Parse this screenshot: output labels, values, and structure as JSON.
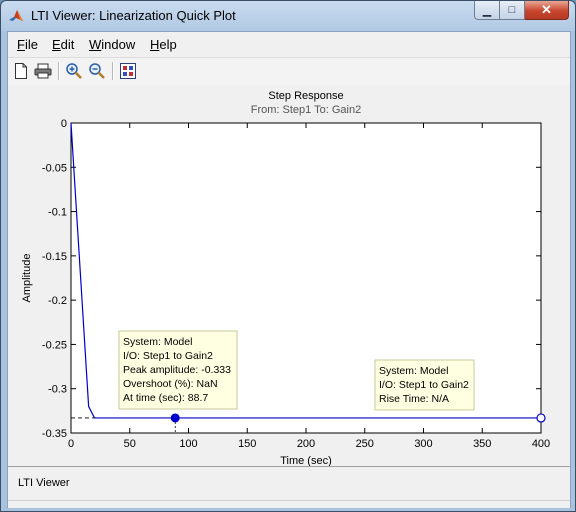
{
  "window": {
    "title": "LTI Viewer: Linearization Quick Plot",
    "controls": {
      "minimize": "▁",
      "maximize": "□",
      "close": "✕"
    }
  },
  "menu": [
    {
      "underline": "F",
      "rest": "ile"
    },
    {
      "underline": "E",
      "rest": "dit"
    },
    {
      "underline": "W",
      "rest": "indow"
    },
    {
      "underline": "H",
      "rest": "elp"
    }
  ],
  "toolbar": {
    "icons": [
      "new-file-icon",
      "print-icon",
      "zoom-in-icon",
      "zoom-out-icon",
      "plot-config-icon"
    ]
  },
  "chart_data": {
    "type": "line",
    "title": "Step Response",
    "subtitle": "From: Step1  To: Gain2",
    "xlabel": "Time (sec)",
    "ylabel": "Amplitude",
    "xlim": [
      0,
      400
    ],
    "ylim": [
      -0.35,
      0
    ],
    "xticks": [
      "0",
      "50",
      "100",
      "150",
      "200",
      "250",
      "300",
      "350",
      "400"
    ],
    "yticks": [
      "0",
      "-0.05",
      "-0.1",
      "-0.15",
      "-0.2",
      "-0.25",
      "-0.3",
      "-0.35"
    ],
    "grid": false,
    "series": [
      {
        "color": "#0000cc",
        "x": [
          0,
          15,
          20,
          88.7,
          400
        ],
        "y": [
          0,
          -0.32,
          -0.333,
          -0.333,
          -0.333
        ]
      }
    ],
    "steady_state": -0.333,
    "markers": [
      {
        "x": 88.7,
        "y": -0.333,
        "filled": true
      },
      {
        "x": 400,
        "y": -0.333,
        "filled": false
      }
    ],
    "datatips": [
      {
        "lines": [
          "System: Model",
          "I/O: Step1 to Gain2",
          "Peak amplitude: -0.333",
          "Overshoot (%): NaN",
          "At time (sec): 88.7"
        ]
      },
      {
        "lines": [
          "System: Model",
          "I/O: Step1 to Gain2",
          "Rise Time: N/A"
        ]
      }
    ],
    "colors": {
      "line": "#0000cc",
      "tip_bg": "#ffffe1",
      "tip_border": "#c8c89a"
    }
  },
  "status": {
    "text": "LTI Viewer"
  }
}
